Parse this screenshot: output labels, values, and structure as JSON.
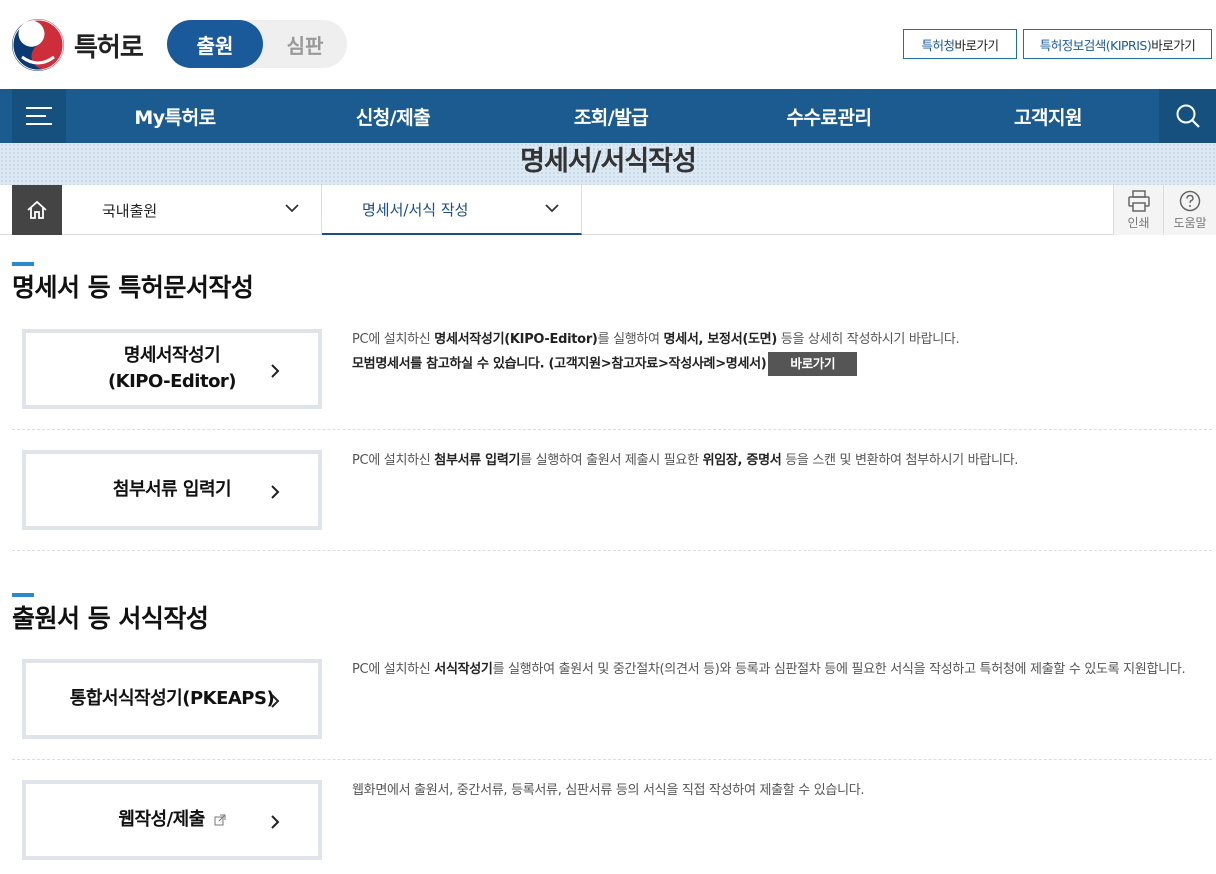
{
  "header": {
    "brand": "특허로",
    "toggle_active": "출원",
    "toggle_inactive": "심판",
    "shortcut1_blue": "특허청",
    "shortcut1_rest": " 바로가기",
    "shortcut2_blue": "특허정보검색(KIPRIS)",
    "shortcut2_rest": " 바로가기"
  },
  "nav": {
    "items": [
      "My특허로",
      "신청/제출",
      "조회/발급",
      "수수료관리",
      "고객지원"
    ],
    "menu_icon": "hamburger-icon",
    "search_icon": "search-icon"
  },
  "banner": {
    "title": "명세서/서식작성"
  },
  "breadcrumb": {
    "level1": "국내출원",
    "level2": "명세서/서식 작성",
    "print_label": "인쇄",
    "help_label": "도움말"
  },
  "section1": {
    "title": "명세서 등 특허문서작성",
    "card1_line1": "명세서작성기",
    "card1_line2": "(KIPO-Editor)",
    "card1_desc_a": "PC에 설치하신 ",
    "card1_desc_b": "명세서작성기(KIPO-Editor)",
    "card1_desc_c": "를 실행하여 ",
    "card1_desc_d": "명세서, 보정서(도면)",
    "card1_desc_e": " 등을 상세히 작성하시기 바랍니다.",
    "card1_desc2": "모범명세서를 참고하실 수 있습니다. (고객지원>참고자료>작성사례>명세서)",
    "card1_button": "바로가기",
    "card2_label": "첨부서류 입력기",
    "card2_desc_a": "PC에 설치하신 ",
    "card2_desc_b": "첨부서류 입력기",
    "card2_desc_c": "를 실행하여 출원서 제출시 필요한 ",
    "card2_desc_d": "위임장, 증명서",
    "card2_desc_e": " 등을 스캔 및 변환하여 첨부하시기 바랍니다."
  },
  "section2": {
    "title": "출원서 등 서식작성",
    "card3_label": "통합서식작성기(PKEAPS)",
    "card3_desc_a": "PC에 설치하신 ",
    "card3_desc_b": "서식작성기",
    "card3_desc_c": "를 실행하여 출원서 및 중간절차(의견서 등)와 등록과 심판절차 등에 필요한 서식을 작성하고 특허청에 제출할 수 있도록 지원합니다.",
    "card4_label": "웹작성/제출",
    "card4_desc": "웹화면에서 출원서, 중간서류, 등록서류, 심판서류 등의 서식을 직접 작성하여 제출할 수 있습니다."
  },
  "colors": {
    "nav": "#1b5b8f",
    "accent": "#1a5a9a",
    "section_bar": "#2b8ac9",
    "card_border": "#dfe4ea"
  }
}
